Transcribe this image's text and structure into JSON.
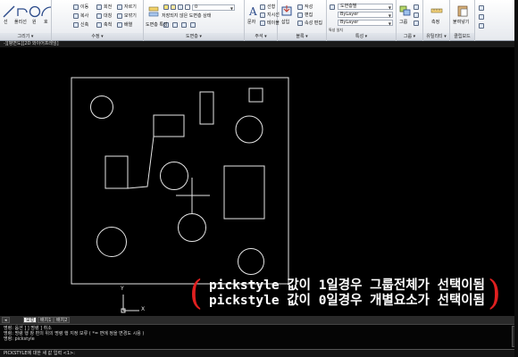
{
  "ribbon": {
    "draw": {
      "line": "선",
      "polyline": "폴리선",
      "circle": "원",
      "arc": "호",
      "title": "그리기 ▾"
    },
    "modify": {
      "move": "이동",
      "rotate": "회전",
      "trim": "자르기",
      "copy": "복사",
      "mirror": "대칭",
      "fillet": "모깎기",
      "stretch": "신축",
      "scale": "축척",
      "array": "배열",
      "title": "수정 ▾"
    },
    "layers": {
      "layer_properties": "도면층 특성",
      "layer_combo": "0",
      "unsaved_state": "저장되지 않은 도면층 상태",
      "title": "도면층 ▾"
    },
    "annotation": {
      "text": "문자",
      "linear": "선형",
      "leader": "지시선",
      "table": "테이블",
      "title": "주석 ▾"
    },
    "block": {
      "insert": "삽입",
      "create": "작성",
      "edit": "편집",
      "edit_attributes": "속성 편집",
      "title": "블록 ▾"
    },
    "properties": {
      "color": "도면층별",
      "linetype": "ByLayer",
      "lineweight": "ByLayer",
      "match": "특성 일치",
      "title": "특성 ▾"
    },
    "groups": {
      "group": "그룹",
      "title": "그룹 ▾"
    },
    "utilities": {
      "measure": "측정",
      "title": "유틸리티 ▾"
    },
    "clipboard": {
      "paste": "붙여넣기",
      "title": "클립보드"
    }
  },
  "file_tab": "-][평면도][2D 와이어프레임]",
  "annotation": {
    "line1": "pickstyle  값이 1일경우 그룹전체가 선택이됨",
    "line2": "pickstyle  값이 0일경우 개별요소가 선택이됨"
  },
  "ucs": {
    "y": "Y",
    "x": "X"
  },
  "layout_tabs": [
    "모형",
    "배치1",
    "배치2"
  ],
  "command": {
    "history1": "명령: 옵션 ] ] 명령 ] 취소",
    "history2": "명령: 명령 행 창 편의 위의 명령 행 지정 보류 ( *= 면에 정을 변경도 시용 )",
    "history3": "명령: pickstyle",
    "prompt": "PICKSTYLE에 대한 새 값 입력 <1>:"
  }
}
